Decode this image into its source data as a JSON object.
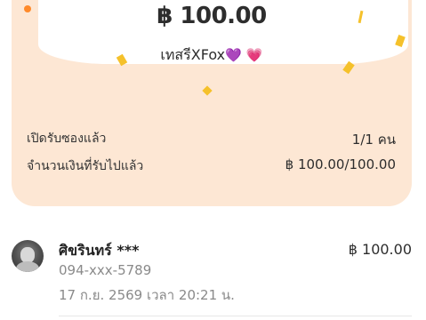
{
  "packet": {
    "amount": "฿ 100.00",
    "sender_name": "เทสรีXFox",
    "sender_emojis": [
      "💜",
      "💗"
    ]
  },
  "summary": {
    "opened_label": "เปิดรับซองแล้ว",
    "opened_value": "1/1 คน",
    "received_label": "จำนวนเงินที่รับไปแล้ว",
    "received_value": "฿ 100.00/100.00"
  },
  "claims": [
    {
      "name": "ศิขรินทร์ ***",
      "phone": "094-xxx-5789",
      "time": "17 ก.ย. 2569 เวลา 20:21 น.",
      "amount": "฿ 100.00"
    }
  ],
  "colors": {
    "panel": "#fde7d4",
    "card": "#ffffff",
    "confetti_yellow": "#f5c12b",
    "confetti_orange": "#ff8a2a",
    "muted_text": "#8a8a8a"
  }
}
